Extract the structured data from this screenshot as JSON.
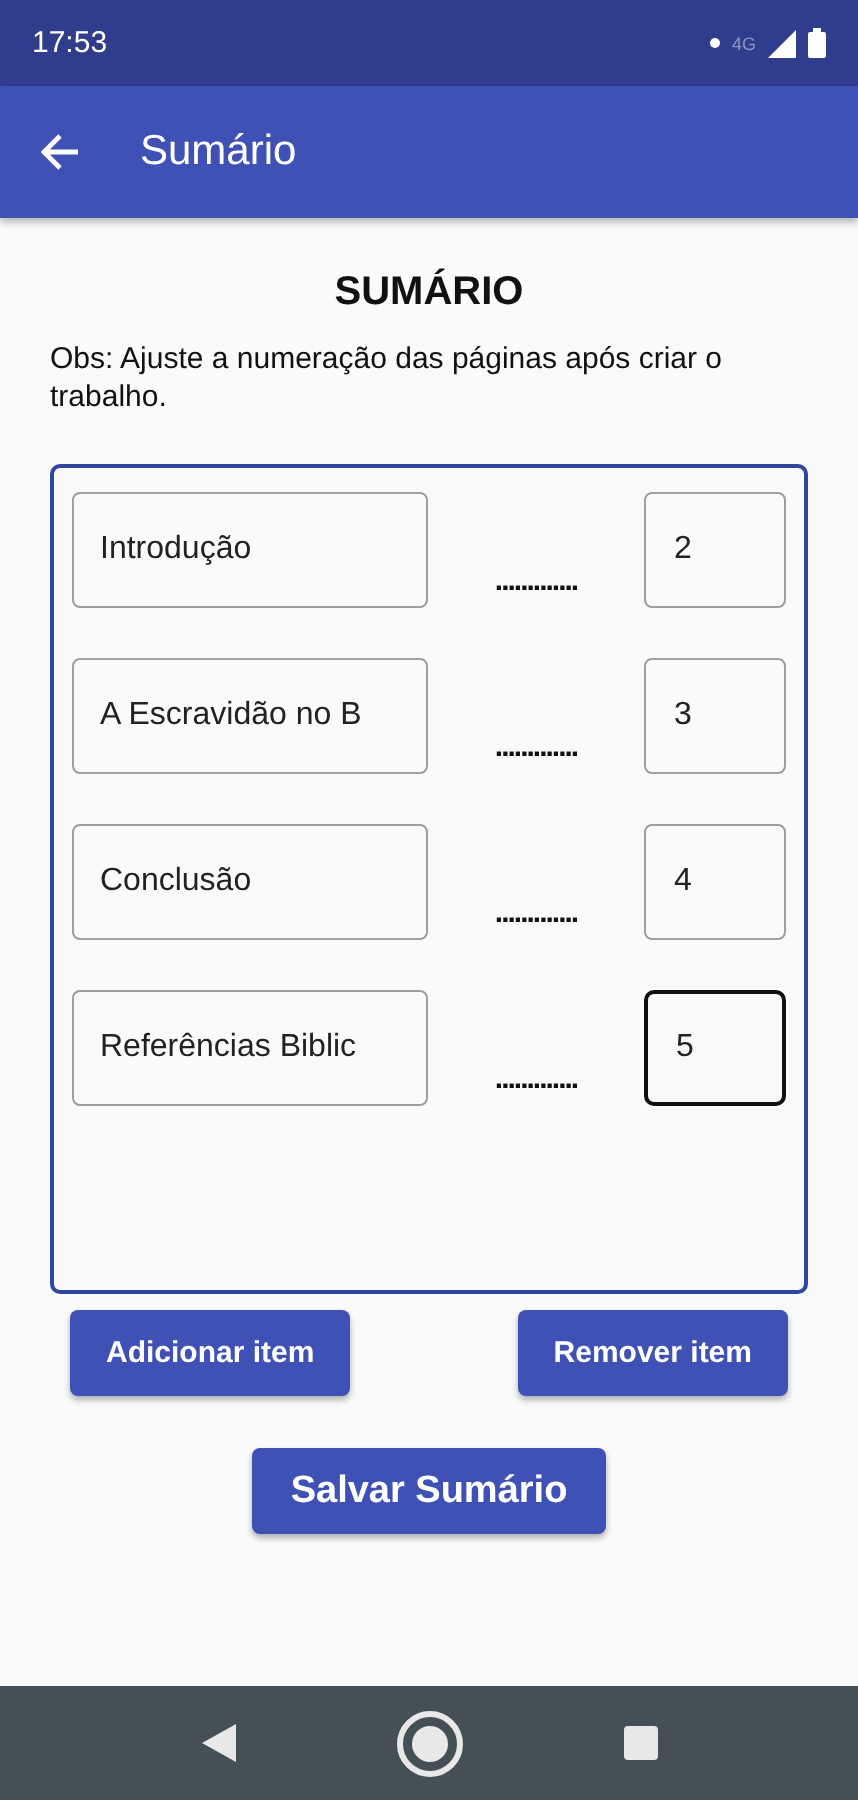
{
  "status_bar": {
    "time": "17:53",
    "network": "4G"
  },
  "app_bar": {
    "title": "Sumário"
  },
  "heading": "SUMÁRIO",
  "note": "Obs: Ajuste a numeração das páginas após criar o trabalho.",
  "items": [
    {
      "title": "Introdução",
      "leader": ".............",
      "page": "2",
      "focused": false
    },
    {
      "title": "A Escravidão no B",
      "leader": ".............",
      "page": "3",
      "focused": false
    },
    {
      "title": "Conclusão",
      "leader": ".............",
      "page": "4",
      "focused": false
    },
    {
      "title": "Referências Biblic",
      "leader": ".............",
      "page": "5",
      "focused": true
    }
  ],
  "buttons": [
    "Adicionar item",
    "Remover item"
  ],
  "save_button": "Salvar Sumário"
}
